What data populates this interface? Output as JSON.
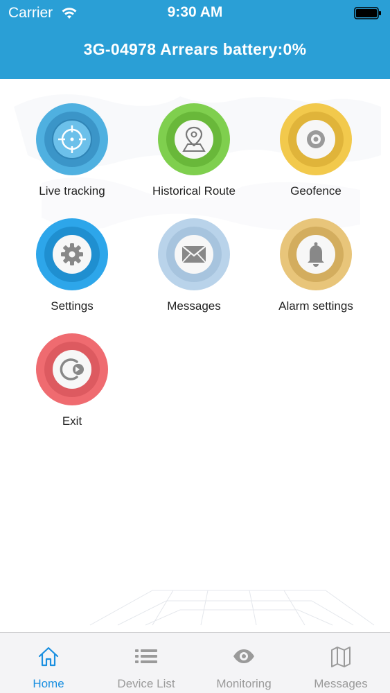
{
  "status_bar": {
    "carrier": "Carrier",
    "time": "9:30 AM"
  },
  "header": {
    "title": "3G-04978 Arrears battery:0%"
  },
  "menu": {
    "items": [
      {
        "label": "Live tracking",
        "icon": "crosshair-icon",
        "color": "#4fb0e0"
      },
      {
        "label": "Historical Route",
        "icon": "map-pin-icon",
        "color": "#7fcf4e"
      },
      {
        "label": "Geofence",
        "icon": "target-icon",
        "color": "#f2c94c"
      },
      {
        "label": "Settings",
        "icon": "gear-icon",
        "color": "#2da6ea"
      },
      {
        "label": "Messages",
        "icon": "envelope-icon",
        "color": "#b9d3ea"
      },
      {
        "label": "Alarm settings",
        "icon": "bell-icon",
        "color": "#e8c57a"
      },
      {
        "label": "Exit",
        "icon": "logout-icon",
        "color": "#ef6b70"
      }
    ]
  },
  "tabbar": {
    "items": [
      {
        "label": "Home",
        "icon": "home-icon",
        "active": true
      },
      {
        "label": "Device List",
        "icon": "list-icon",
        "active": false
      },
      {
        "label": "Monitoring",
        "icon": "eye-icon",
        "active": false
      },
      {
        "label": "Messages",
        "icon": "map-icon",
        "active": false
      }
    ],
    "active_color": "#1a8fe0",
    "inactive_color": "#9a9a9a"
  },
  "colors": {
    "header": "#2a9fd6"
  }
}
